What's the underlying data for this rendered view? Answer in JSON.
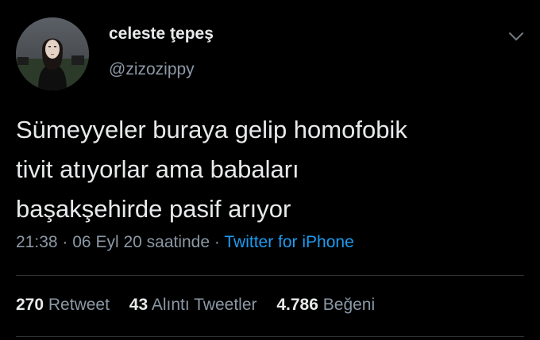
{
  "user": {
    "display_name": "celeste ţepeş",
    "handle": "@zizozippy"
  },
  "tweet": {
    "text_lines": [
      "Sümeyyeler buraya gelip homofobik",
      "tivit atıyorlar ama babaları",
      "başakşehirde pasif arıyor"
    ],
    "time": "21:38",
    "date_text": "06 Eyl 20 saatinde",
    "source": "Twitter for iPhone",
    "separator": "·"
  },
  "stats": {
    "retweets_count": "270",
    "retweets_label": "Retweet",
    "quotes_count": "43",
    "quotes_label": "Alıntı Tweetler",
    "likes_count": "4.786",
    "likes_label": "Beğeni"
  },
  "icons": {
    "menu": "chevron-down-icon",
    "avatar": "profile-photo"
  },
  "colors": {
    "background": "#000000",
    "text_primary": "#e7e9ea",
    "text_secondary": "#8b98a5",
    "link": "#1d9bf0",
    "divider": "#2f3336"
  }
}
